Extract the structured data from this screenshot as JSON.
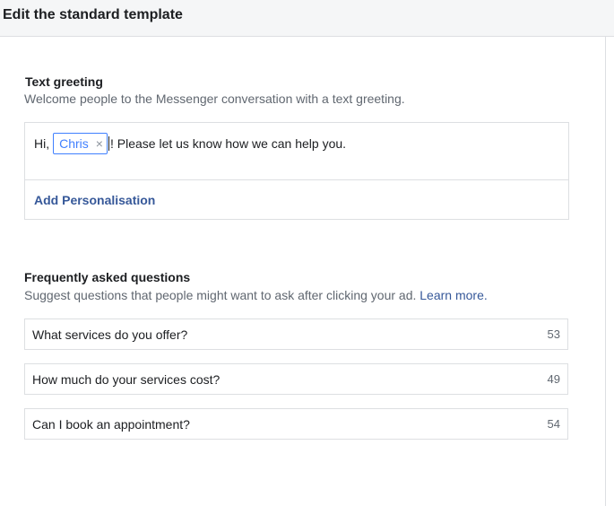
{
  "header": {
    "title": "Edit the standard template"
  },
  "greeting": {
    "title": "Text greeting",
    "description": "Welcome people to the Messenger conversation with a text greeting.",
    "prefix": "Hi,",
    "token": "Chris",
    "token_close": "×",
    "suffix": "! Please let us know how we can help you.",
    "add_personalisation": "Add Personalisation"
  },
  "faq": {
    "title": "Frequently asked questions",
    "description": "Suggest questions that people might want to ask after clicking your ad.",
    "learn_more": "Learn more.",
    "questions": [
      {
        "text": "What services do you offer?",
        "count": "53"
      },
      {
        "text": "How much do your services cost?",
        "count": "49"
      },
      {
        "text": "Can I book an appointment?",
        "count": "54"
      }
    ]
  }
}
